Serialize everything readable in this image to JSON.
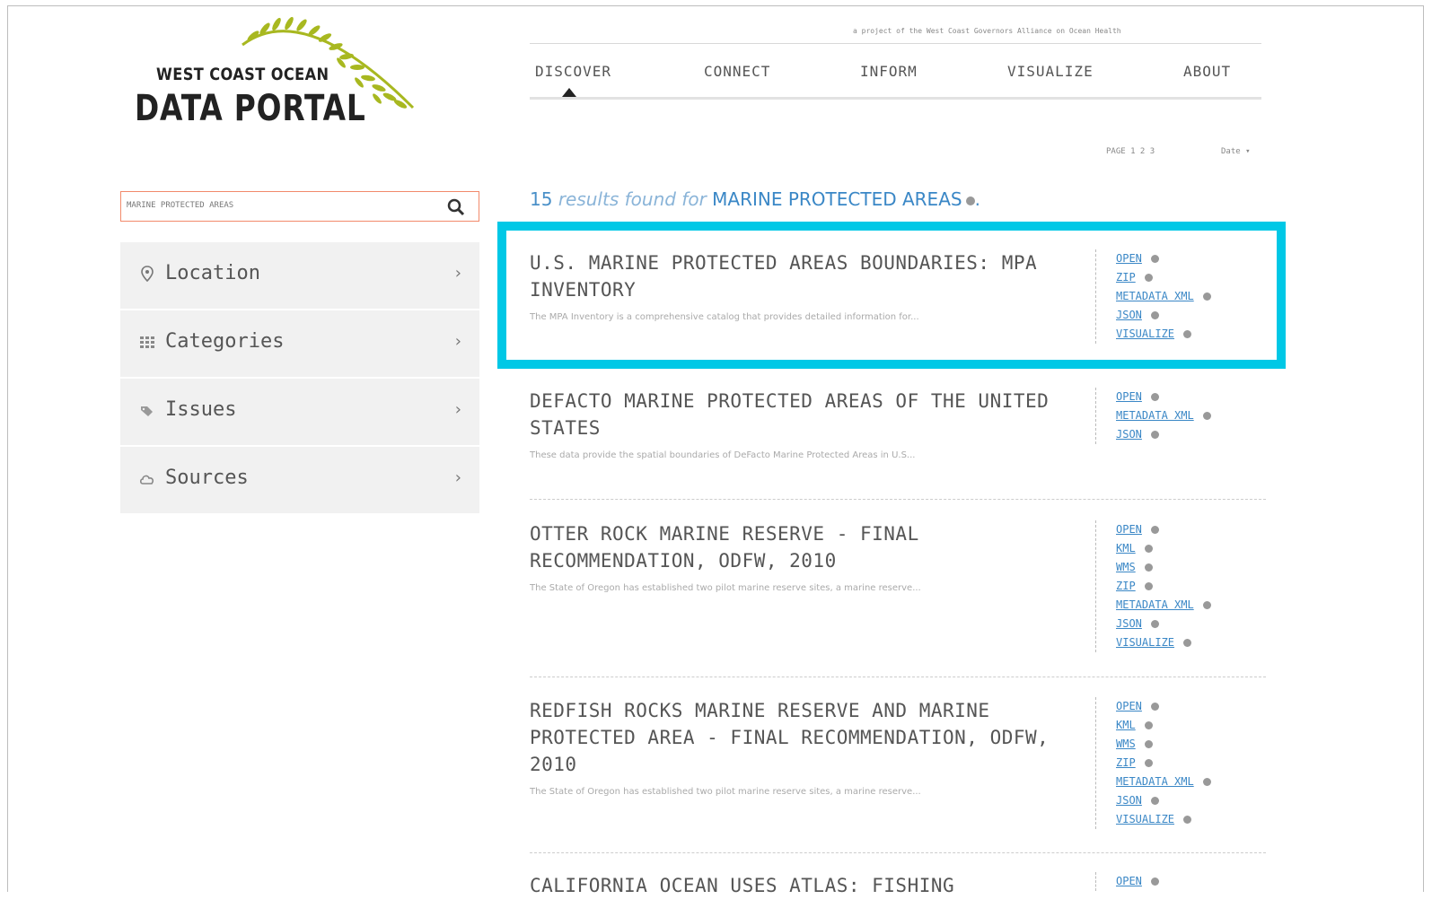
{
  "logo": {
    "line1": "WEST COAST OCEAN",
    "line2": "DATA PORTAL"
  },
  "tagline": "a project of the West Coast Governors Alliance on Ocean Health",
  "nav": {
    "items": [
      {
        "label": "DISCOVER",
        "active": true
      },
      {
        "label": "CONNECT"
      },
      {
        "label": "INFORM"
      },
      {
        "label": "VISUALIZE"
      },
      {
        "label": "ABOUT"
      }
    ]
  },
  "pager": {
    "label": "PAGE 1 2 3",
    "sort": "Date ▾"
  },
  "search": {
    "value": "MARINE PROTECTED AREAS"
  },
  "sidebar": {
    "items": [
      {
        "label": "Location",
        "icon": "pin-icon"
      },
      {
        "label": "Categories",
        "icon": "grid-icon"
      },
      {
        "label": "Issues",
        "icon": "tags-icon"
      },
      {
        "label": "Sources",
        "icon": "cloud-icon"
      }
    ]
  },
  "results_summary": {
    "count": "15",
    "phrase": "results found for",
    "query": "MARINE PROTECTED AREAS",
    "end": "."
  },
  "results": [
    {
      "title": "U.S. MARINE PROTECTED AREAS BOUNDARIES: MPA INVENTORY",
      "desc": "The MPA Inventory is a comprehensive catalog that provides detailed information for...",
      "links": [
        "OPEN",
        "ZIP",
        "METADATA XML",
        "JSON",
        "VISUALIZE"
      ]
    },
    {
      "title": "DEFACTO MARINE PROTECTED AREAS OF THE UNITED STATES",
      "desc": "These data provide the spatial boundaries of DeFacto Marine Protected Areas in U.S...",
      "links": [
        "OPEN",
        "METADATA XML",
        "JSON"
      ]
    },
    {
      "title": "OTTER ROCK MARINE RESERVE - FINAL RECOMMENDATION, ODFW, 2010",
      "desc": "The State of Oregon has established two pilot marine reserve sites, a marine reserve...",
      "links": [
        "OPEN",
        "KML",
        "WMS",
        "ZIP",
        "METADATA XML",
        "JSON",
        "VISUALIZE"
      ]
    },
    {
      "title": "REDFISH ROCKS MARINE RESERVE AND MARINE PROTECTED AREA - FINAL RECOMMENDATION, ODFW, 2010",
      "desc": "The State of Oregon has established two pilot marine reserve sites, a marine reserve...",
      "links": [
        "OPEN",
        "KML",
        "WMS",
        "ZIP",
        "METADATA XML",
        "JSON",
        "VISUALIZE"
      ]
    },
    {
      "title": "CALIFORNIA OCEAN USES ATLAS: FISHING",
      "desc": "",
      "links": [
        "OPEN"
      ]
    }
  ],
  "colors": {
    "highlight": "#00c8e6",
    "link": "#3a87c6",
    "search_border": "#f28a6b",
    "leaf": "#a8b820"
  }
}
